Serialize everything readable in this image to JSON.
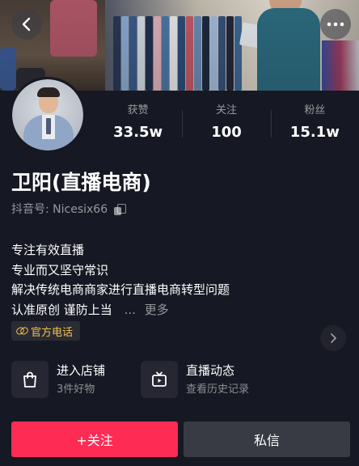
{
  "header": {
    "back_icon": "chevron-left-icon",
    "more_icon": "more-dots-icon"
  },
  "stats": [
    {
      "label": "获赞",
      "value": "33.5w"
    },
    {
      "label": "关注",
      "value": "100"
    },
    {
      "label": "粉丝",
      "value": "15.1w"
    }
  ],
  "profile": {
    "name": "卫阳(直播电商)",
    "handle": "抖音号: Nicesix66"
  },
  "bio": {
    "lines": [
      "专注有效直播",
      "专业而又坚守常识",
      "解决传统电商商家进行直播电商转型问题",
      "认准原创 谨防上当"
    ],
    "ellipsis": "...",
    "more": "更多"
  },
  "tag": {
    "label": "官方电话",
    "color": "#f4c04a"
  },
  "features": {
    "store": {
      "title": "进入店铺",
      "subtitle": "3件好物"
    },
    "live": {
      "title": "直播动态",
      "subtitle": "查看历史记录"
    }
  },
  "actions": {
    "follow": "+关注",
    "message": "私信",
    "follow_color": "#fe2c55"
  }
}
